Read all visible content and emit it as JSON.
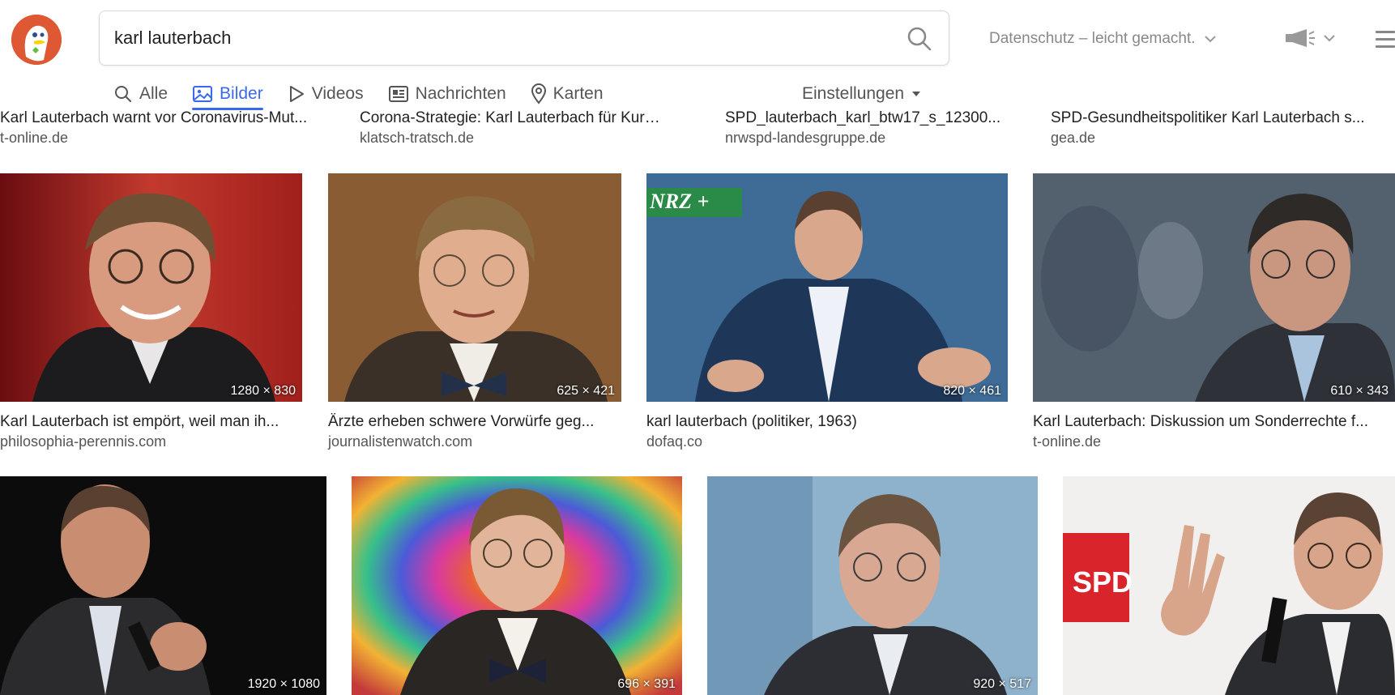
{
  "search": {
    "query": "karl lauterbach",
    "privacy_label": "Datenschutz – leicht gemacht."
  },
  "tabs": [
    {
      "label": "Alle",
      "icon": "search-icon"
    },
    {
      "label": "Bilder",
      "icon": "image-icon",
      "active": true
    },
    {
      "label": "Videos",
      "icon": "play-icon"
    },
    {
      "label": "Nachrichten",
      "icon": "newspaper-icon"
    },
    {
      "label": "Karten",
      "icon": "map-pin-icon"
    }
  ],
  "settings_label": "Einstellungen",
  "colors": {
    "accent": "#3969ef",
    "logo": "#de5833"
  },
  "rows": [
    {
      "items": [
        {
          "title": "Karl Lauterbach warnt vor Coronavirus-Mut...",
          "domain": "t-online.de"
        },
        {
          "title": "Corona-Strategie: Karl Lauterbach für Kurzu...",
          "domain": "klatsch-tratsch.de"
        },
        {
          "title": "SPD_lauterbach_karl_btw17_s_12300...",
          "domain": "nrwspd-landesgruppe.de"
        },
        {
          "title": "SPD-Gesundheitspolitiker Karl Lauterbach s...",
          "domain": "gea.de"
        }
      ]
    },
    {
      "items": [
        {
          "title": "Karl Lauterbach ist empört, weil man ih...",
          "domain": "philosophia-perennis.com",
          "dimensions": "1280 × 830"
        },
        {
          "title": "Ärzte erheben schwere Vorwürfe geg...",
          "domain": "journalistenwatch.com",
          "dimensions": "625 × 421"
        },
        {
          "title": "karl lauterbach (politiker, 1963)",
          "domain": "dofaq.co",
          "dimensions": "820 × 461",
          "overlay": "NRZ +"
        },
        {
          "title": "Karl Lauterbach: Diskussion um Sonderrechte f...",
          "domain": "t-online.de",
          "dimensions": "610 × 343"
        }
      ]
    },
    {
      "items": [
        {
          "dimensions": "1920 × 1080"
        },
        {
          "dimensions": "696 × 391"
        },
        {
          "dimensions": "920 × 517"
        },
        {
          "overlay": "SPD"
        }
      ]
    }
  ]
}
